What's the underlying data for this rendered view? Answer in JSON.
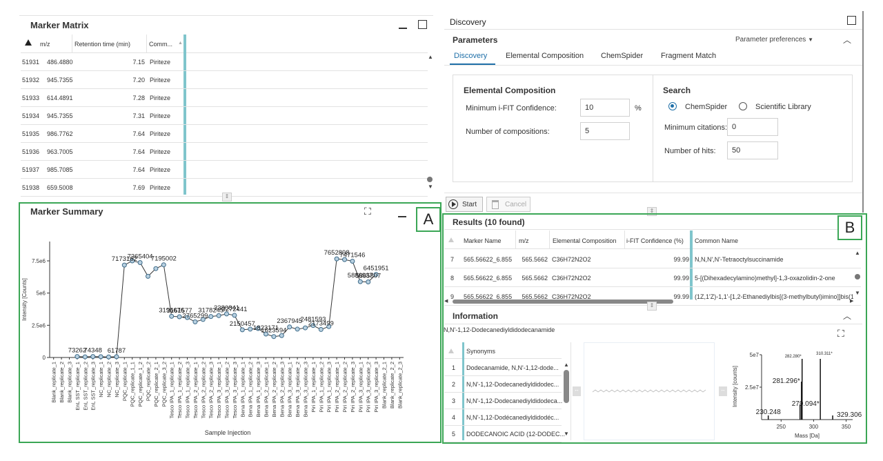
{
  "marker_matrix": {
    "title": "Marker Matrix",
    "columns": [
      "m/z",
      "Retention time (min)",
      "Comm..."
    ],
    "rows": [
      {
        "id": "51931",
        "mz": "486.4880",
        "rt": "7.15",
        "comm": "Piriteze"
      },
      {
        "id": "51932",
        "mz": "945.7355",
        "rt": "7.20",
        "comm": "Piriteze"
      },
      {
        "id": "51933",
        "mz": "614.4891",
        "rt": "7.28",
        "comm": "Piriteze"
      },
      {
        "id": "51934",
        "mz": "945.7355",
        "rt": "7.31",
        "comm": "Piriteze"
      },
      {
        "id": "51935",
        "mz": "986.7762",
        "rt": "7.64",
        "comm": "Piriteze"
      },
      {
        "id": "51936",
        "mz": "963.7005",
        "rt": "7.64",
        "comm": "Piriteze"
      },
      {
        "id": "51937",
        "mz": "985.7085",
        "rt": "7.64",
        "comm": "Piriteze"
      },
      {
        "id": "51938",
        "mz": "659.5008",
        "rt": "7.69",
        "comm": "Piriteze"
      }
    ]
  },
  "marker_summary": {
    "title": "Marker Summary"
  },
  "label_a": "A",
  "label_b": "B",
  "chart_data": {
    "type": "line",
    "xlabel": "Sample Injection",
    "ylabel": "Intensity [Counts]",
    "ylim": [
      0,
      9000000
    ],
    "yticks": [
      "0",
      "2.5e6",
      "5e6",
      "7.5e6"
    ],
    "categories": [
      "Blank_replicate_1",
      "Blank_replicate_2",
      "Blank_replicate_3",
      "EnL SST_replicate_1",
      "EnL SST_replicate_2",
      "EnL SST_replicate_3",
      "NC_replicate_1",
      "NC_replicate_2",
      "NC_replicate_3",
      "PQC_replicate_1",
      "PQC_replicate_1_1",
      "PQC_replicate_1_2",
      "PQC_replicate_2",
      "PQC_replicate_2_1",
      "PQC_replicate_3_2",
      "Tesco IPA_1_replicate_1",
      "Tesco IPA_1_replicate_2",
      "Tesco IPA_1_replicate_3",
      "Tesco IPA_2_replicate_1",
      "Tesco IPA_2_replicate_2",
      "Tesco IPA_2_replicate_3",
      "Tesco IPA_3_replicate_1",
      "Tesco IPA_3_replicate_2",
      "Tesco IPA_3_replicate_3",
      "Bena IPA_1_replicate_1",
      "Bena IPA_1_replicate_2",
      "Bena IPA_1_replicate_3",
      "Bena IPA_2_replicate_1",
      "Bena IPA_2_replicate_2",
      "Bena IPA_2_replicate_3",
      "Bena IPA_3_replicate_1",
      "Bena IPA_3_replicate_2",
      "Bena IPA_3_replicate_3",
      "Piri IPA_1_replicate_1",
      "Piri IPA_1_replicate_2",
      "Piri IPA_1_replicate_3",
      "Piri IPA_2_replicate_1",
      "Piri IPA_2_replicate_2",
      "Piri IPA_2_replicate_3",
      "Piri IPA_3_replicate_1",
      "Piri IPA_3_replicate_2",
      "Piri IPA_3_replicate_3",
      "Blank_replicate_2_1",
      "Blank_replicate_2_2",
      "Blank_replicate_2_3"
    ],
    "values": [
      null,
      null,
      null,
      73262,
      50000,
      74348,
      60000,
      40000,
      61787,
      7173162,
      7500000,
      7365404,
      6300000,
      6900000,
      7195002,
      3196676,
      3161577,
      3100000,
      2765299,
      2950000,
      3178245,
      3250000,
      3380841,
      3272441,
      2150457,
      2200000,
      2250000,
      1823171,
      1623594,
      1700000,
      2367945,
      2200000,
      2300000,
      2481593,
      2173499,
      2400000,
      7652898,
      7600000,
      7471546,
      5886937,
      5865807,
      6451951,
      null,
      null,
      null
    ],
    "data_labels": [
      {
        "i": 3,
        "text": "73262"
      },
      {
        "i": 5,
        "text": "74348"
      },
      {
        "i": 8,
        "text": "61787"
      },
      {
        "i": 9,
        "text": "7173162"
      },
      {
        "i": 11,
        "text": "7365404"
      },
      {
        "i": 14,
        "text": "7195002"
      },
      {
        "i": 15,
        "text": "3196676"
      },
      {
        "i": 16,
        "text": "3161577"
      },
      {
        "i": 18,
        "text": "2765299"
      },
      {
        "i": 20,
        "text": "3178245"
      },
      {
        "i": 22,
        "text": "3380841"
      },
      {
        "i": 23,
        "text": "3272441"
      },
      {
        "i": 24,
        "text": "2150457"
      },
      {
        "i": 27,
        "text": "1823171"
      },
      {
        "i": 28,
        "text": "1623594"
      },
      {
        "i": 30,
        "text": "2367945"
      },
      {
        "i": 33,
        "text": "2481593"
      },
      {
        "i": 34,
        "text": "2173499"
      },
      {
        "i": 36,
        "text": "7652898"
      },
      {
        "i": 38,
        "text": "7471546"
      },
      {
        "i": 39,
        "text": "5886937"
      },
      {
        "i": 40,
        "text": "5865807"
      },
      {
        "i": 41,
        "text": "6451951"
      }
    ]
  },
  "discovery": {
    "title": "Discovery",
    "parameters_title": "Parameters",
    "param_prefs": "Parameter preferences",
    "tabs": [
      "Discovery",
      "Elemental Composition",
      "ChemSpider",
      "Fragment Match"
    ],
    "elemental": {
      "title": "Elemental Composition",
      "min_ifit_label": "Minimum i-FIT Confidence:",
      "min_ifit_value": "10",
      "min_ifit_unit": "%",
      "num_comp_label": "Number of compositions:",
      "num_comp_value": "5"
    },
    "search": {
      "title": "Search",
      "opt1": "ChemSpider",
      "opt2": "Scientific Library",
      "min_cit_label": "Minimum citations:",
      "min_cit_value": "0",
      "num_hits_label": "Number of hits:",
      "num_hits_value": "50"
    },
    "start": "Start",
    "cancel": "Cancel"
  },
  "results": {
    "title": "Results (10 found)",
    "columns": [
      "Marker Name",
      "m/z",
      "Elemental Composition",
      "i-FIT Confidence (%)",
      "Common Name"
    ],
    "rows": [
      {
        "n": "7",
        "name": "565.56622_6.855",
        "mz": "565.5662",
        "ec": "C36H72N2O2",
        "conf": "99.99",
        "common": "N,N,N',N'-Tetraoctylsuccinamide"
      },
      {
        "n": "8",
        "name": "565.56622_6.855",
        "mz": "565.5662",
        "ec": "C36H72N2O2",
        "conf": "99.99",
        "common": "5-[(Dihexadecylamino)methyl]-1,3-oxazolidin-2-one"
      },
      {
        "n": "9",
        "name": "565.56622_6.855",
        "mz": "565.5662",
        "ec": "C36H72N2O2",
        "conf": "99.99",
        "common": "(1Z,1'Z)-1,1'-[1,2-Ethanediylbis[(3-methylbutyl)imino]]bis(1-"
      }
    ]
  },
  "information": {
    "title": "Information",
    "compound": "N,N'-1,12-Dodecanediyldidodecanamide",
    "synonyms_header": "Synonyms",
    "synonyms": [
      {
        "n": "1",
        "text": "Dodecanamide, N,N'-1,12-dode..."
      },
      {
        "n": "2",
        "text": "N,N'-1,12-Dodecanediyldidodec..."
      },
      {
        "n": "3",
        "text": "N,N'-1,12-Dodecanediyldidodeca..."
      },
      {
        "n": "4",
        "text": "N,N'-1,12-Dodécanediyldidodéc..."
      },
      {
        "n": "5",
        "text": "DODECANOIC ACID (12-DODEC..."
      }
    ],
    "spectrum": {
      "ylabel": "Intensity [counts]",
      "xlabel": "Mass [Da]",
      "yticks": [
        "5e7",
        "2.5e7",
        "0"
      ],
      "xticks": [
        "250",
        "300",
        "350"
      ],
      "peaks": [
        {
          "mz": 230.248,
          "label": "230.248"
        },
        {
          "mz": 279.094,
          "label": "279.094*"
        },
        {
          "mz": 281.296,
          "label": "281.296*"
        },
        {
          "mz": 282.28,
          "label": "282.280*"
        },
        {
          "mz": 310.311,
          "label": "310.311*"
        },
        {
          "mz": 329.306,
          "label": "329.306"
        }
      ]
    }
  }
}
